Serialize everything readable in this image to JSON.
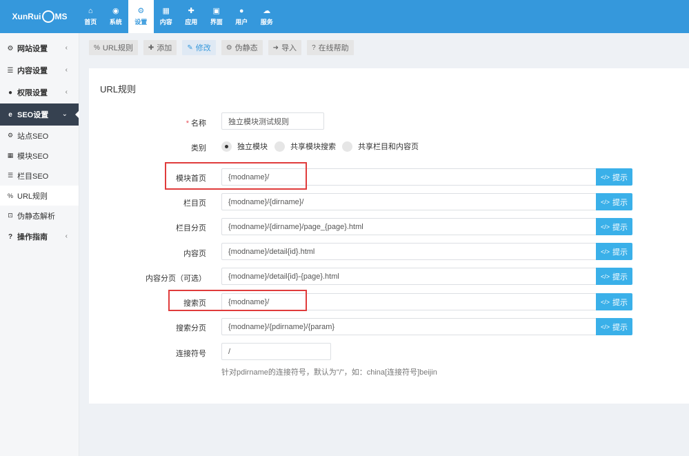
{
  "brand": {
    "name_left": "XunRui",
    "name_right": "MS"
  },
  "topnav": [
    {
      "label": "首页",
      "icon": "home-icon",
      "glyph": "⌂"
    },
    {
      "label": "系统",
      "icon": "globe-icon",
      "glyph": "◉"
    },
    {
      "label": "设置",
      "icon": "cogs-icon",
      "glyph": "⚙"
    },
    {
      "label": "内容",
      "icon": "grid-icon",
      "glyph": "▦"
    },
    {
      "label": "应用",
      "icon": "puzzle-icon",
      "glyph": "✚"
    },
    {
      "label": "界面",
      "icon": "html5-icon",
      "glyph": "▣"
    },
    {
      "label": "用户",
      "icon": "user-icon",
      "glyph": "●"
    },
    {
      "label": "服务",
      "icon": "cloud-icon",
      "glyph": "☁"
    }
  ],
  "sidebar": {
    "groups": [
      {
        "label": "网站设置",
        "icon": "gear-icon",
        "glyph": "⚙"
      },
      {
        "label": "内容设置",
        "icon": "bars-icon",
        "glyph": "☰"
      },
      {
        "label": "权限设置",
        "icon": "user-icon",
        "glyph": "●"
      },
      {
        "label": "SEO设置",
        "icon": "ie-icon",
        "glyph": "e"
      }
    ],
    "seo_items": [
      {
        "label": "站点SEO",
        "icon": "gear-icon",
        "glyph": "⚙"
      },
      {
        "label": "模块SEO",
        "icon": "th-large-icon",
        "glyph": "▦"
      },
      {
        "label": "栏目SEO",
        "icon": "list-icon",
        "glyph": "☰"
      },
      {
        "label": "URL规则",
        "icon": "link-icon",
        "glyph": "%"
      },
      {
        "label": "伪静态解析",
        "icon": "code-icon",
        "glyph": "⊡"
      }
    ],
    "guide": {
      "label": "操作指南",
      "icon": "question-icon",
      "glyph": "?"
    }
  },
  "toolbar": [
    {
      "label": "URL规则",
      "icon": "link-icon",
      "glyph": "%"
    },
    {
      "label": "添加",
      "icon": "plus-icon",
      "glyph": "✚"
    },
    {
      "label": "修改",
      "icon": "edit-icon",
      "glyph": "✎"
    },
    {
      "label": "伪静态",
      "icon": "gear-icon",
      "glyph": "⚙"
    },
    {
      "label": "导入",
      "icon": "sign-in-icon",
      "glyph": "➜"
    },
    {
      "label": "在线帮助",
      "icon": "question-icon",
      "glyph": "?"
    }
  ],
  "panel": {
    "title": "URL规则",
    "name_label": "名称",
    "name_value": "独立模块测试规则",
    "type_label": "类别",
    "type_options": [
      "独立模块",
      "共享模块搜索",
      "共享栏目和内容页"
    ],
    "hint_label": "提示",
    "hint_glyph": "</>",
    "rows": [
      {
        "label": "模块首页",
        "value": "{modname}/"
      },
      {
        "label": "栏目页",
        "value": "{modname}/{dirname}/"
      },
      {
        "label": "栏目分页",
        "value": "{modname}/{dirname}/page_{page}.html"
      },
      {
        "label": "内容页",
        "value": "{modname}/detail{id}.html"
      },
      {
        "label": "内容分页（可选）",
        "value": "{modname}/detail{id}-{page}.html"
      },
      {
        "label": "搜索页",
        "value": "{modname}/"
      },
      {
        "label": "搜索分页",
        "value": "{modname}/{pdirname}/{param}"
      }
    ],
    "sep_label": "连接符号",
    "sep_value": "/",
    "sep_help": "针对pdirname的连接符号，默认为\"/\"，如：china[连接符号]beijin"
  },
  "colors": {
    "brand_blue": "#3598dc",
    "sidebar_active": "#364150",
    "hint_button": "#3ab0e9",
    "highlight_box": "#e03b3b"
  }
}
